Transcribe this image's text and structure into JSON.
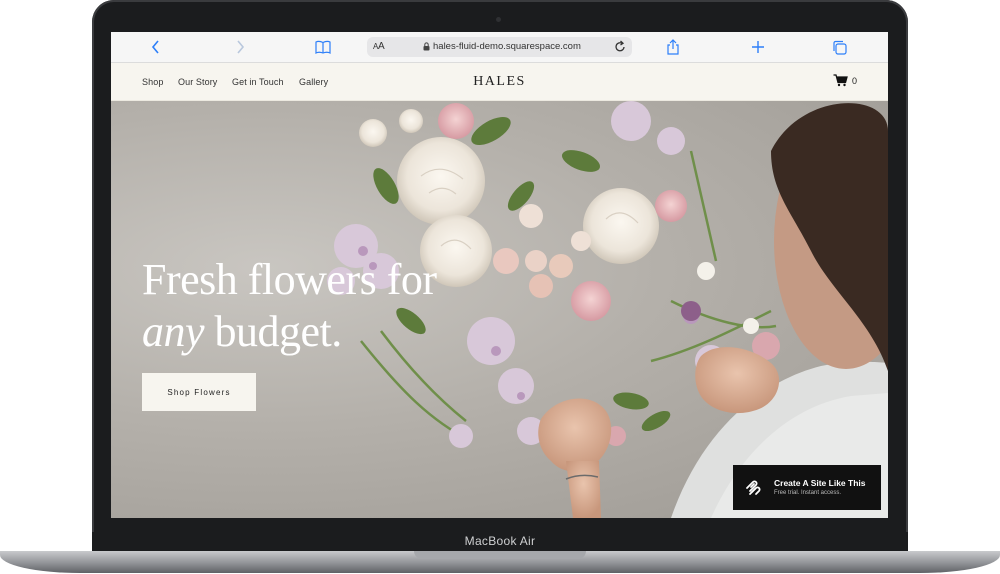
{
  "browser": {
    "aa_label_small": "A",
    "aa_label_big": "A",
    "url": "hales-fluid-demo.squarespace.com"
  },
  "site": {
    "nav": [
      "Shop",
      "Our Story",
      "Get in Touch",
      "Gallery"
    ],
    "logo": "HALES",
    "cart_count": "0"
  },
  "hero": {
    "headline_line1": "Fresh flowers for",
    "headline_italic": "any",
    "headline_line2_rest": " budget.",
    "cta_label": "Shop Flowers"
  },
  "badge": {
    "title": "Create A Site Like This",
    "subtitle": "Free trial. Instant access."
  },
  "device": {
    "label": "MacBook Air"
  },
  "colors": {
    "accent": "#2d7ff9",
    "nav_bg": "#f7f5ef",
    "bezel": "#1b1c1e"
  }
}
